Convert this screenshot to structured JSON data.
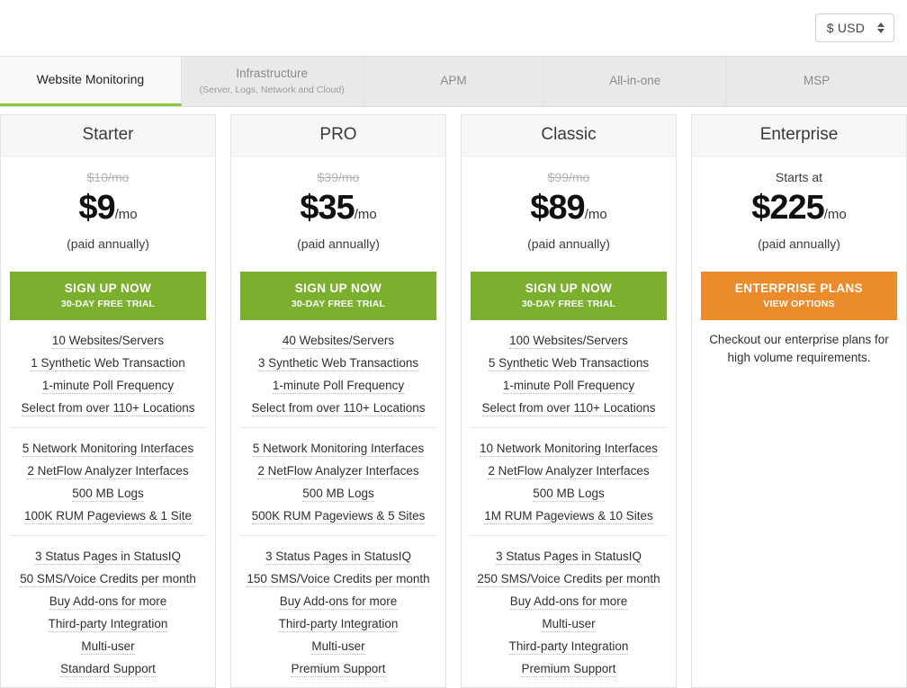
{
  "currency": {
    "selected": "$ USD",
    "icon": "spinner-arrows-icon"
  },
  "tabs": [
    {
      "label": "Website Monitoring",
      "sub": "",
      "active": true
    },
    {
      "label": "Infrastructure",
      "sub": "(Server, Logs, Network and Cloud)",
      "active": false
    },
    {
      "label": "APM",
      "sub": "",
      "active": false
    },
    {
      "label": "All-in-one",
      "sub": "",
      "active": false
    },
    {
      "label": "MSP",
      "sub": "",
      "active": false
    }
  ],
  "colors": {
    "accent_green": "#7ab02e",
    "accent_orange": "#ec8b2c",
    "active_tab_underline": "#8cc63e"
  },
  "plans": [
    {
      "name": "Starter",
      "old_price": "$10/mo",
      "starts_at_label": "",
      "amount": "$9",
      "per": "/mo",
      "paid_note": "(paid annually)",
      "cta_main": "SIGN UP NOW",
      "cta_sub": "30-DAY FREE TRIAL",
      "cta_style": "green",
      "note": "",
      "feature_groups": [
        [
          "10 Websites/Servers",
          "1 Synthetic Web Transaction",
          "1-minute Poll Frequency",
          "Select from over 110+ Locations"
        ],
        [
          "5 Network Monitoring Interfaces",
          "2 NetFlow Analyzer Interfaces",
          "500 MB Logs",
          "100K RUM Pageviews & 1 Site"
        ],
        [
          "3 Status Pages in StatusIQ",
          "50 SMS/Voice Credits per month",
          "Buy Add-ons for more",
          "Third-party Integration",
          "Multi-user",
          "Standard Support"
        ]
      ]
    },
    {
      "name": "PRO",
      "old_price": "$39/mo",
      "starts_at_label": "",
      "amount": "$35",
      "per": "/mo",
      "paid_note": "(paid annually)",
      "cta_main": "SIGN UP NOW",
      "cta_sub": "30-DAY FREE TRIAL",
      "cta_style": "green",
      "note": "",
      "feature_groups": [
        [
          "40 Websites/Servers",
          "3 Synthetic Web Transactions",
          "1-minute Poll Frequency",
          "Select from over 110+ Locations"
        ],
        [
          "5 Network Monitoring Interfaces",
          "2 NetFlow Analyzer Interfaces",
          "500 MB Logs",
          "500K RUM Pageviews & 5 Sites"
        ],
        [
          "3 Status Pages in StatusIQ",
          "150 SMS/Voice Credits per month",
          "Buy Add-ons for more",
          "Third-party Integration",
          "Multi-user",
          "Premium Support"
        ]
      ]
    },
    {
      "name": "Classic",
      "old_price": "$99/mo",
      "starts_at_label": "",
      "amount": "$89",
      "per": "/mo",
      "paid_note": "(paid annually)",
      "cta_main": "SIGN UP NOW",
      "cta_sub": "30-DAY FREE TRIAL",
      "cta_style": "green",
      "note": "",
      "feature_groups": [
        [
          "100 Websites/Servers",
          "5 Synthetic Web Transactions",
          "1-minute Poll Frequency",
          "Select from over 110+ Locations"
        ],
        [
          "10 Network Monitoring Interfaces",
          "2 NetFlow Analyzer Interfaces",
          "500 MB Logs",
          "1M RUM Pageviews & 10 Sites"
        ],
        [
          "3 Status Pages in StatusIQ",
          "250 SMS/Voice Credits per month",
          "Buy Add-ons for more",
          "Multi-user",
          "Third-party Integration",
          "Premium Support"
        ]
      ]
    },
    {
      "name": "Enterprise",
      "old_price": "",
      "starts_at_label": "Starts at",
      "amount": "$225",
      "per": "/mo",
      "paid_note": "(paid annually)",
      "cta_main": "ENTERPRISE PLANS",
      "cta_sub": "VIEW OPTIONS",
      "cta_style": "orange",
      "note": "Checkout our enterprise plans for high volume requirements.",
      "feature_groups": []
    }
  ]
}
